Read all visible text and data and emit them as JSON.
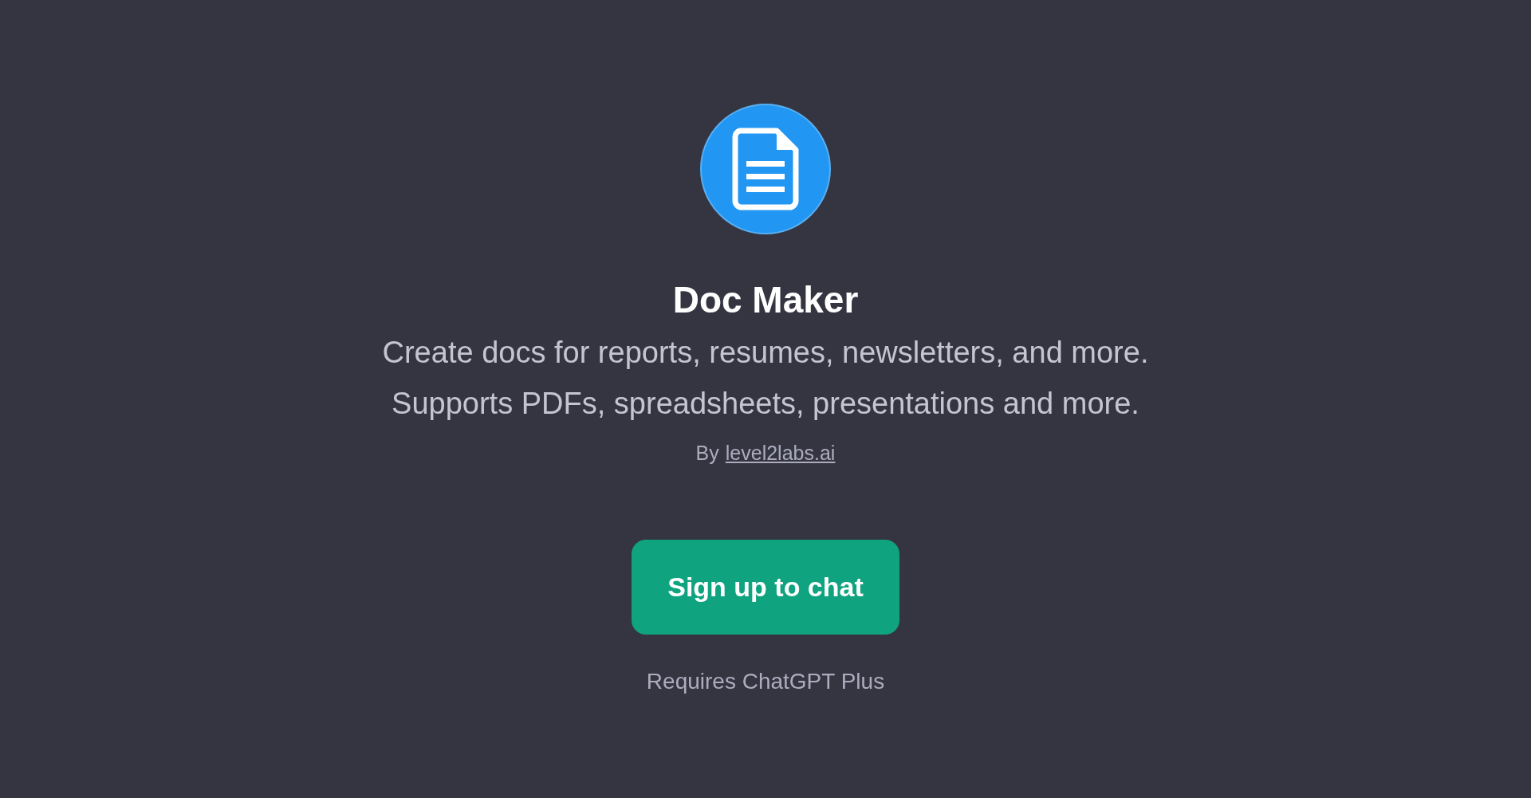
{
  "title": "Doc Maker",
  "description": "Create docs for reports, resumes, newsletters, and more. Supports PDFs, spreadsheets, presentations and more.",
  "author": {
    "prefix": "By",
    "link": "level2labs.ai"
  },
  "button": "Sign up to chat",
  "note": "Requires ChatGPT Plus"
}
